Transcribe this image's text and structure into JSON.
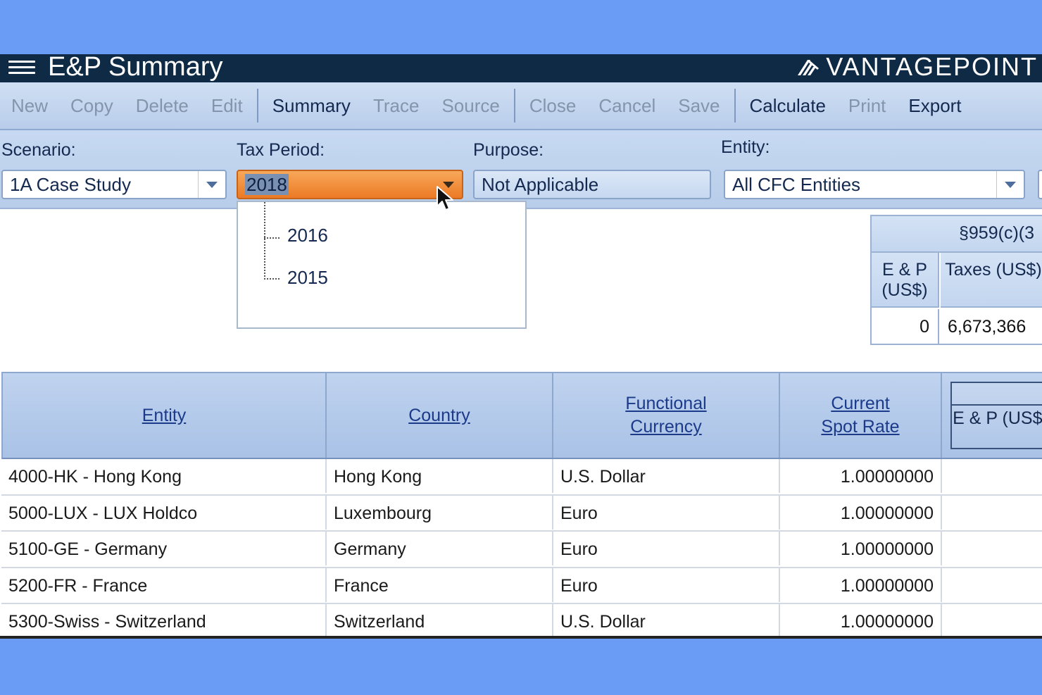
{
  "header": {
    "title": "E&P Summary",
    "brand": "VANTAGEPOINT"
  },
  "toolbar": {
    "new": "New",
    "copy": "Copy",
    "delete": "Delete",
    "edit": "Edit",
    "summary": "Summary",
    "trace": "Trace",
    "source": "Source",
    "close": "Close",
    "cancel": "Cancel",
    "save": "Save",
    "calculate": "Calculate",
    "print": "Print",
    "export": "Export"
  },
  "filters": {
    "scenario_label": "Scenario:",
    "scenario_value": "1A Case Study",
    "tax_period_label": "Tax Period:",
    "tax_period_value": "2018",
    "purpose_label": "Purpose:",
    "purpose_value": "Not Applicable",
    "entity_label": "Entity:",
    "entity_value": "All CFC Entities"
  },
  "tax_period_dropdown": {
    "options": [
      "2016",
      "2015"
    ]
  },
  "section_table": {
    "title": "§959(c)(3",
    "col1": "E & P (US$)",
    "col2": "Taxes (US$)",
    "val1": "0",
    "val2": "6,673,366"
  },
  "grid": {
    "columns": {
      "entity": "Entity",
      "country": "Country",
      "currency": "Functional Currency",
      "spot_rate": "Current Spot Rate",
      "ep": "E & P (US$)"
    },
    "rows": [
      {
        "entity": "4000-HK - Hong Kong",
        "country": "Hong Kong",
        "currency": "U.S. Dollar",
        "rate": "1.00000000"
      },
      {
        "entity": "5000-LUX - LUX Holdco",
        "country": "Luxembourg",
        "currency": "Euro",
        "rate": "1.00000000"
      },
      {
        "entity": "5100-GE - Germany",
        "country": "Germany",
        "currency": "Euro",
        "rate": "1.00000000"
      },
      {
        "entity": "5200-FR - France",
        "country": "France",
        "currency": "Euro",
        "rate": "1.00000000"
      },
      {
        "entity": "5300-Swiss - Switzerland",
        "country": "Switzerland",
        "currency": "U.S. Dollar",
        "rate": "1.00000000"
      }
    ]
  }
}
